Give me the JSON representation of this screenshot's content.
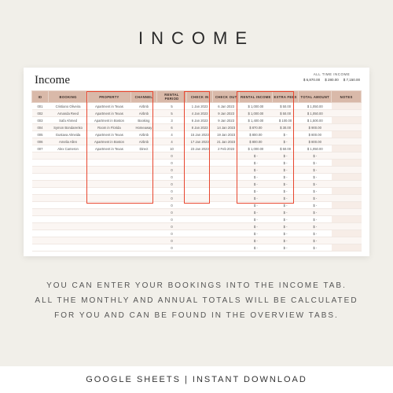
{
  "title": "INCOME",
  "sheet_label": "Income",
  "summary": {
    "label": "ALL TIME INCOME",
    "vals": [
      "$  6,870.00",
      "$  280.00",
      "$  7,150.00"
    ]
  },
  "headers": [
    "ID",
    "BOOKING",
    "PROPERTY",
    "CHANNEL",
    "RENTAL PERIOD",
    "CHECK IN",
    "CHECK OUT",
    "RENTAL INCOME",
    "EXTRA FEES",
    "TOTAL AMOUNT",
    "NOTES"
  ],
  "rows": [
    [
      "001",
      "Cristiano Oliveira",
      "Apartment in Texas",
      "Airbnb",
      "5",
      "1 Jan 2023",
      "6 Jan 2023",
      "$  1,000.00",
      "$  50.00",
      "$  1,050.00",
      ""
    ],
    [
      "002",
      "Amanda Reed",
      "Apartment in Texas",
      "Airbnb",
      "5",
      "4 Jan 2023",
      "9 Jan 2023",
      "$  1,000.00",
      "$  50.00",
      "$  1,050.00",
      ""
    ],
    [
      "003",
      "Safa Ahmed",
      "Apartment in Boston",
      "Booking",
      "3",
      "6 Jan 2023",
      "9 Jan 2023",
      "$  1,400.00",
      "$  100.00",
      "$  1,500.00",
      ""
    ],
    [
      "004",
      "Symon Bondarenko",
      "Room in Florida",
      "Homeaway",
      "6",
      "8 Jan 2023",
      "14 Jan 2023",
      "$  870.00",
      "$  30.00",
      "$  900.00",
      ""
    ],
    [
      "005",
      "Gustava Almeida",
      "Apartment in Texas",
      "Airbnb",
      "4",
      "15 Jan 2023",
      "19 Jan 2023",
      "$  800.00",
      "$  -",
      "$  800.00",
      ""
    ],
    [
      "006",
      "Amelia Allen",
      "Apartment in Boston",
      "Airbnb",
      "4",
      "17 Jan 2023",
      "21 Jan 2023",
      "$  800.00",
      "$  -",
      "$  800.00",
      ""
    ],
    [
      "007",
      "Alex Cameron",
      "Apartment in Texas",
      "Direct",
      "10",
      "23 Jan 2023",
      "2 Feb 2023",
      "$  1,000.00",
      "$  50.00",
      "$  1,050.00",
      ""
    ]
  ],
  "empty_rows": 14,
  "description_lines": [
    "YOU CAN ENTER YOUR BOOKINGS INTO THE INCOME TAB.",
    "ALL THE MONTHLY AND ANNUAL TOTALS WILL BE CALCULATED",
    "FOR YOU AND CAN BE FOUND IN THE OVERVIEW TABS."
  ],
  "footer": "GOOGLE SHEETS | INSTANT DOWNLOAD"
}
